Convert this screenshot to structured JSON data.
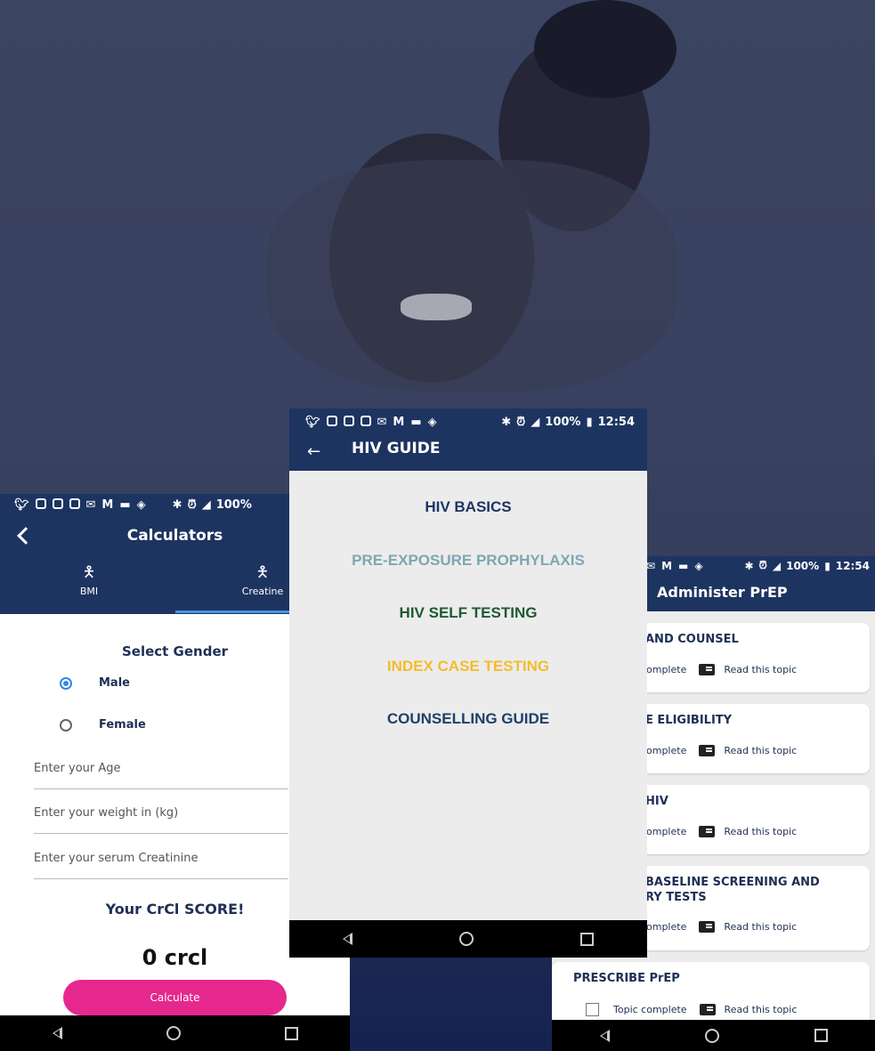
{
  "calculators": {
    "status_battery": "100%",
    "title": "Calculators",
    "tabs": [
      {
        "label": "BMI"
      },
      {
        "label": "Creatine"
      }
    ],
    "select_gender_label": "Select Gender",
    "gender_options": [
      {
        "label": "Male",
        "selected": true
      },
      {
        "label": "Female",
        "selected": false
      }
    ],
    "fields": {
      "age_placeholder": "Enter your Age",
      "weight_placeholder": "Enter your weight in (kg)",
      "creatinine_placeholder": "Enter your serum Creatinine"
    },
    "score_label": "Your CrCl SCORE!",
    "score_value": "0 crcl",
    "calculate_label": "Calculate"
  },
  "hiv_guide": {
    "status_battery": "100%",
    "status_time": "12:54",
    "title": "HIV GUIDE",
    "menu": [
      {
        "label": "HIV BASICS",
        "color": "#1e3563"
      },
      {
        "label": "PRE-EXPOSURE PROPHYLAXIS",
        "color": "#7fa6b3"
      },
      {
        "label": "HIV SELF TESTING",
        "color": "#1f5a34"
      },
      {
        "label": "INDEX CASE TESTING",
        "color": "#f2bd2c"
      },
      {
        "label": "COUNSELLING GUIDE",
        "color": "#1e3f6b"
      }
    ]
  },
  "administer_prep": {
    "status_battery": "100%",
    "status_time": "12:54",
    "title": "Administer PrEP",
    "cards": [
      {
        "title": "AND COUNSEL",
        "complete_label": "omplete",
        "read_label": "Read this topic"
      },
      {
        "title": "E ELIGIBILITY",
        "complete_label": "omplete",
        "read_label": "Read this topic"
      },
      {
        "title": "HIV",
        "complete_label": "omplete",
        "read_label": "Read this topic"
      },
      {
        "title_line1": "BASELINE SCREENING AND",
        "title_line2": "RY TESTS",
        "complete_label": "omplete",
        "read_label": "Read this topic"
      },
      {
        "title": "PRESCRIBE PrEP",
        "complete_label": "Topic complete",
        "read_label": "Read this topic"
      }
    ]
  }
}
